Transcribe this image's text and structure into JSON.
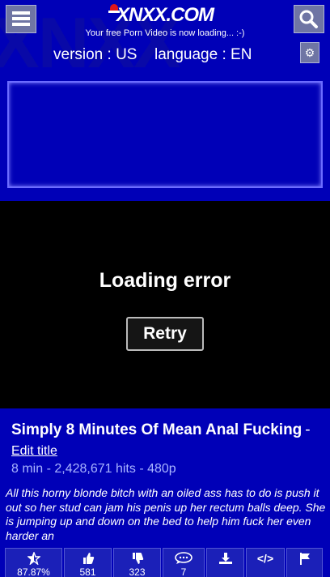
{
  "header": {
    "logo_text": "XNXX.COM",
    "tagline": "Your free Porn Video is now loading... :-)",
    "version_label": "version : US",
    "language_label": "language : EN"
  },
  "player": {
    "error_text": "Loading error",
    "retry_label": "Retry"
  },
  "video": {
    "title": "Simply 8 Minutes Of Mean Anal Fucking",
    "title_separator": "-",
    "edit_title_label": "Edit title",
    "meta": "8 min - 2,428,671 hits - 480p",
    "description": "All this horny blonde bitch with an oiled ass has to do is push it out so her stud can jam his penis up her rectum balls deep. She is jumping up and down on the bed to help him fuck her even harder an"
  },
  "actions": [
    {
      "icon": "star-half-icon",
      "label": "87.87%"
    },
    {
      "icon": "thumbs-up-icon",
      "label": "581"
    },
    {
      "icon": "thumbs-down-icon",
      "label": "323"
    },
    {
      "icon": "comment-icon",
      "label": "7"
    },
    {
      "icon": "download-icon",
      "label": ""
    },
    {
      "icon": "embed-code-icon",
      "label": ""
    },
    {
      "icon": "flag-icon",
      "label": ""
    }
  ],
  "colors": {
    "brand_blue": "#0000b7",
    "button_grey": "#6f75a4",
    "meta_text": "#a9b4ff"
  }
}
